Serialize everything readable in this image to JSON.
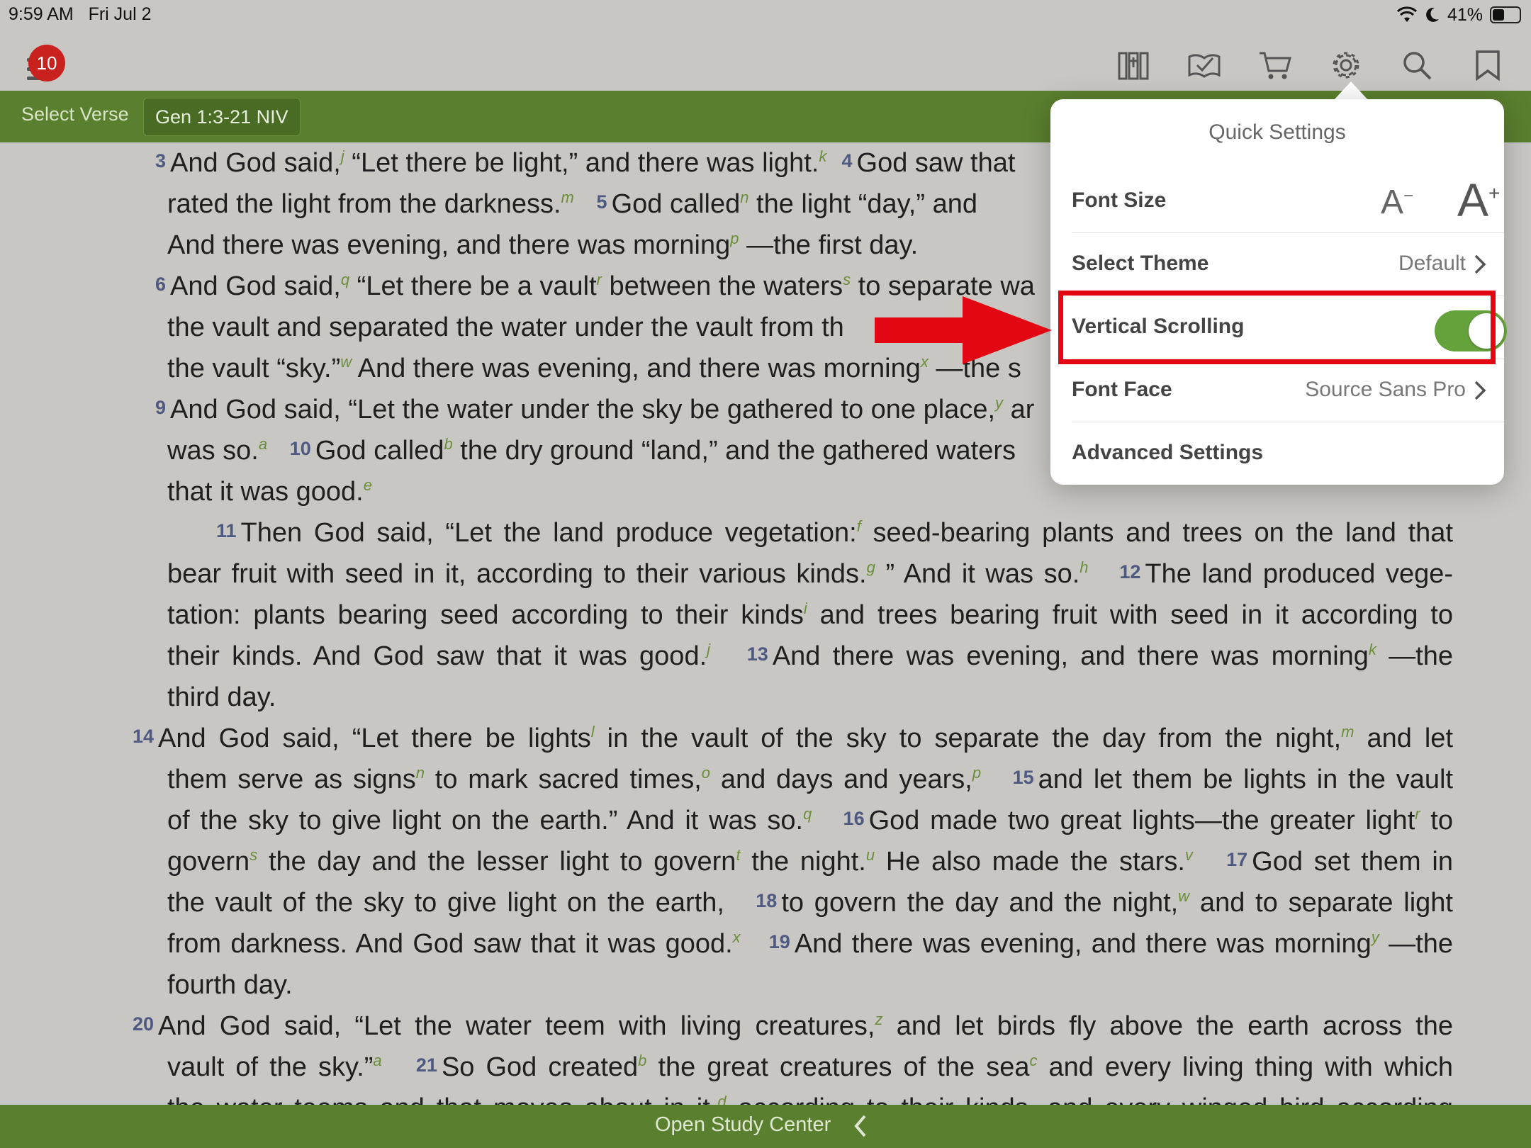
{
  "status_bar": {
    "time": "9:59 AM",
    "date": "Fri Jul 2",
    "battery": "41%"
  },
  "toolbar": {
    "badge_count": "10",
    "icons": [
      "library-icon",
      "reading-plan-icon",
      "cart-icon",
      "gear-icon",
      "search-icon",
      "bookmark-icon"
    ]
  },
  "verse_bar": {
    "select_verse": "Select Verse",
    "passage": "Gen 1:3-21 NIV"
  },
  "bottom_bar": {
    "label": "Open Study Center"
  },
  "quick_settings": {
    "title": "Quick Settings",
    "font_size_label": "Font Size",
    "font_smaller": "A",
    "font_smaller_sign": "−",
    "font_larger": "A",
    "font_larger_sign": "+",
    "theme_label": "Select Theme",
    "theme_value": "Default",
    "vertical_scrolling_label": "Vertical Scrolling",
    "vertical_scrolling_on": true,
    "font_face_label": "Font Face",
    "font_face_value": "Source Sans Pro",
    "advanced_label": "Advanced Settings"
  },
  "colors": {
    "accent_green": "#5a7f2e",
    "toggle_on": "#66a23c",
    "annotation_red": "#e30613",
    "badge_red": "#c9211e"
  },
  "bible_lines": {
    "l0": {
      "v": "3",
      "t1": "And God said,",
      "f1": "j",
      "t2": " “Let there be light,” and there was light.",
      "f2": "k",
      "v2": "4",
      "t3": "God saw that"
    },
    "l1": {
      "t1": "rated the light from the darkness.",
      "f1": "m",
      "v2": "5",
      "t2": "God called",
      "f2": "n",
      "t3": " the light “day,” and"
    },
    "l2": {
      "t1": "And there was evening, and there was morning",
      "f1": "p",
      "t2": " —the first day."
    },
    "l3": {
      "v": "6",
      "t1": "And God said,",
      "f1": "q",
      "t2": " “Let there be a vault",
      "f2": "r",
      "t3": " between the waters",
      "f3": "s",
      "t4": " to separate wa"
    },
    "l4": {
      "t1": "the vault and separated the water under the vault from th"
    },
    "l5": {
      "t1": "the vault “sky.”",
      "f1": "w",
      "t2": " And there was evening, and there was morning",
      "f2": "x",
      "t3": " —the s"
    },
    "l6": {
      "v": "9",
      "t1": "And God said, “Let the water under the sky be gathered to one place,",
      "f1": "y",
      "t2": " ar"
    },
    "l7": {
      "t1": "was so.",
      "f1": "a",
      "v2": "10",
      "t2": "God called",
      "f2": "b",
      "t3": " the dry ground “land,” and the gathered waters"
    },
    "l8": {
      "t1": "that it was good.",
      "f1": "e"
    },
    "l9": {
      "v": "11",
      "t1": "Then God said, “Let the land produce vegetation:",
      "f1": "f",
      "t2": " seed-bearing plants and trees on the land that"
    },
    "l10": {
      "t1": "bear fruit with seed in it, according to their various kinds.",
      "f1": "g",
      "t2": " ” And it was so.",
      "f2": "h",
      "v2": "12",
      "t3": "The land produced vege-"
    },
    "l11": {
      "t1": "tation: plants bearing seed according to their kinds",
      "f1": "i",
      "t2": " and trees bearing fruit with seed in it according to"
    },
    "l12": {
      "t1": "their kinds. And God saw that it was good.",
      "f1": "j",
      "v2": "13",
      "t2": "And there was evening, and there was morning",
      "f2": "k",
      "t3": " —the"
    },
    "l13": {
      "t1": "third day."
    },
    "l14": {
      "v": "14",
      "t1": "And God said, “Let there be lights",
      "f1": "l",
      "t2": " in the vault of the sky to separate the day from the night,",
      "f2": "m",
      "t3": " and let"
    },
    "l15": {
      "t1": "them serve as signs",
      "f1": "n",
      "t2": " to mark sacred times,",
      "f2": "o",
      "t3": " and days and years,",
      "f3": "p",
      "v2": "15",
      "t4": "and let them be lights in the vault"
    },
    "l16": {
      "t1": "of the sky to give light on the earth.” And it was so.",
      "f1": "q",
      "v2": "16",
      "t2": "God made two great lights—the greater light",
      "f2": "r",
      "t3": " to"
    },
    "l17": {
      "t1": "govern",
      "f1": "s",
      "t2": " the day and the lesser light to govern",
      "f2": "t",
      "t3": " the night.",
      "f3": "u",
      "t4": " He also made the stars.",
      "f4": "v",
      "v2": "17",
      "t5": "God set them in"
    },
    "l18": {
      "t1": "the vault of the sky to give light on the earth,",
      "v2": "18",
      "t2": "to govern the day and the night,",
      "f1": "w",
      "t3": " and to separate light"
    },
    "l19": {
      "t1": "from darkness. And God saw that it was good.",
      "f1": "x",
      "v2": "19",
      "t2": "And there was evening, and there was morning",
      "f2": "y",
      "t3": " —the"
    },
    "l20": {
      "t1": "fourth day."
    },
    "l21": {
      "v": "20",
      "t1": "And God said, “Let the water teem with living creatures,",
      "f1": "z",
      "t2": " and let birds fly above the earth across the"
    },
    "l22": {
      "t1": "vault of the sky.”",
      "f1": "a",
      "v2": "21",
      "t2": "So God created",
      "f2": "b",
      "t3": " the great creatures of the sea",
      "f3": "c",
      "t4": " and every living thing with which"
    },
    "l23": {
      "t1": "the water teems and that moves about in it,",
      "f1": "d",
      "t2": " according to their kinds, and every winged bird according"
    }
  }
}
